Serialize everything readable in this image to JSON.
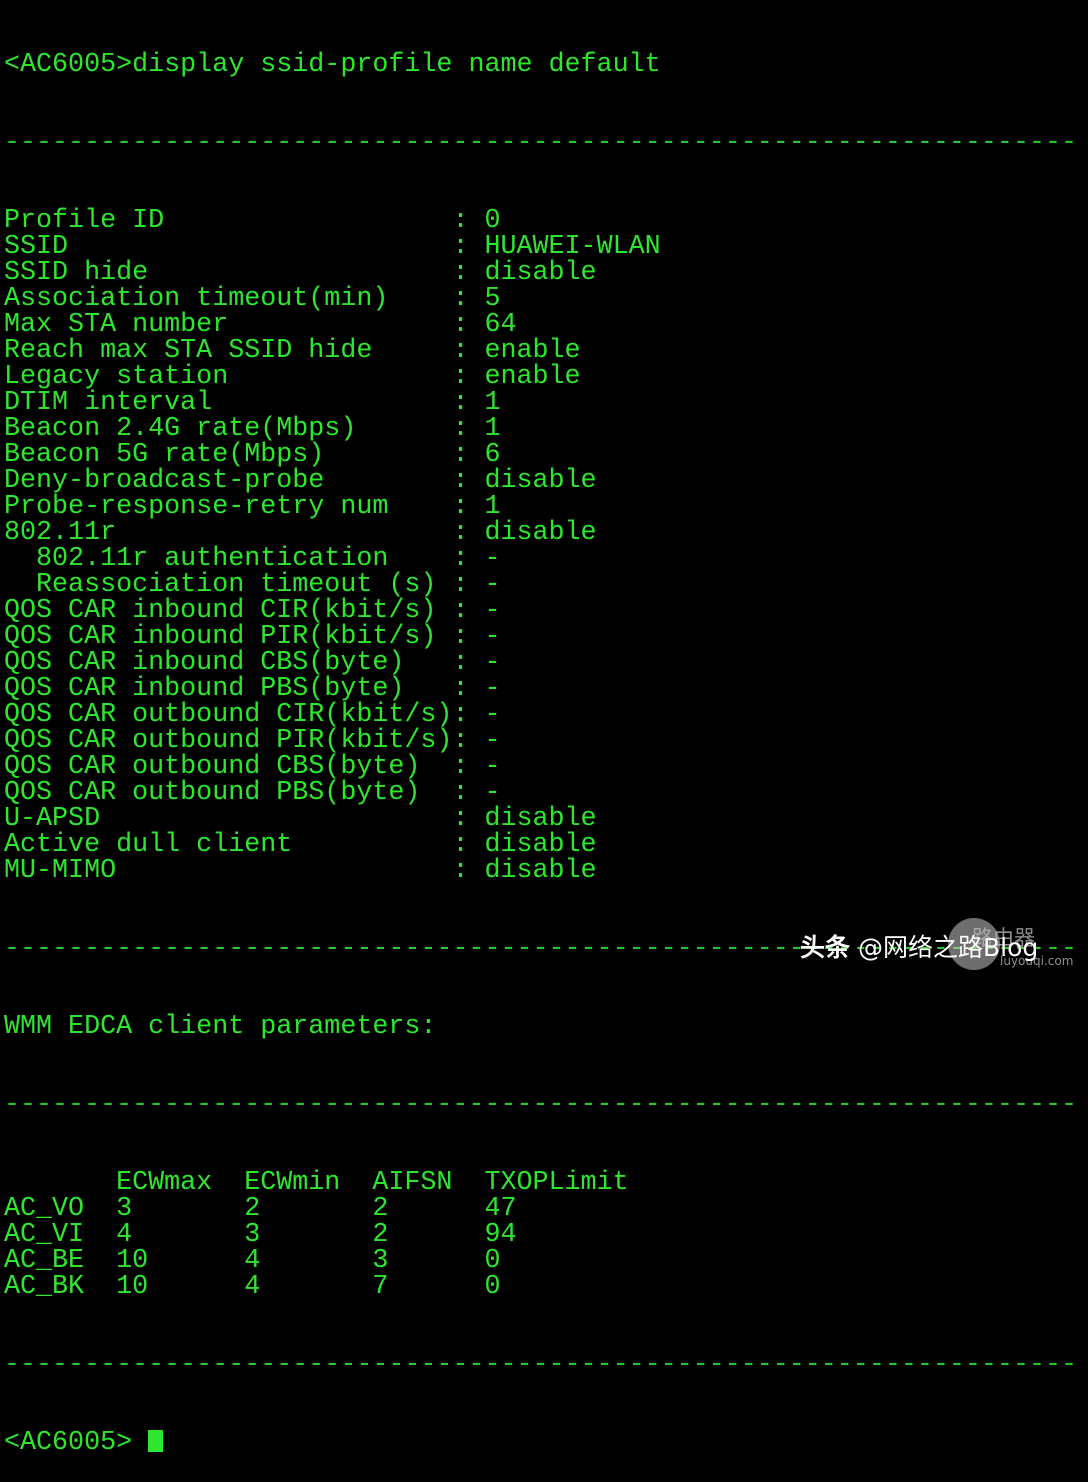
{
  "terminal": {
    "command_line": "<AC6005>display ssid-profile name default",
    "separator": "-------------------------------------------------------------------",
    "fields": [
      {
        "label": "Profile ID",
        "value": "0"
      },
      {
        "label": "SSID",
        "value": "HUAWEI-WLAN"
      },
      {
        "label": "SSID hide",
        "value": "disable"
      },
      {
        "label": "Association timeout(min)",
        "value": "5"
      },
      {
        "label": "Max STA number",
        "value": "64"
      },
      {
        "label": "Reach max STA SSID hide",
        "value": "enable"
      },
      {
        "label": "Legacy station",
        "value": "enable"
      },
      {
        "label": "DTIM interval",
        "value": "1"
      },
      {
        "label": "Beacon 2.4G rate(Mbps)",
        "value": "1"
      },
      {
        "label": "Beacon 5G rate(Mbps)",
        "value": "6"
      },
      {
        "label": "Deny-broadcast-probe",
        "value": "disable"
      },
      {
        "label": "Probe-response-retry num",
        "value": "1"
      },
      {
        "label": "802.11r",
        "value": "disable"
      },
      {
        "label": "  802.11r authentication",
        "value": "-"
      },
      {
        "label": "  Reassociation timeout (s)",
        "value": "-"
      },
      {
        "label": "QOS CAR inbound CIR(kbit/s)",
        "value": "-"
      },
      {
        "label": "QOS CAR inbound PIR(kbit/s)",
        "value": "-"
      },
      {
        "label": "QOS CAR inbound CBS(byte)",
        "value": "-"
      },
      {
        "label": "QOS CAR inbound PBS(byte)",
        "value": "-"
      },
      {
        "label": "QOS CAR outbound CIR(kbit/s)",
        "value": "-"
      },
      {
        "label": "QOS CAR outbound PIR(kbit/s)",
        "value": "-"
      },
      {
        "label": "QOS CAR outbound CBS(byte)",
        "value": "-"
      },
      {
        "label": "QOS CAR outbound PBS(byte)",
        "value": "-"
      },
      {
        "label": "U-APSD",
        "value": "disable"
      },
      {
        "label": "Active dull client",
        "value": "disable"
      },
      {
        "label": "MU-MIMO",
        "value": "disable"
      }
    ],
    "wmm_title": "WMM EDCA client parameters:",
    "wmm_headers": [
      "",
      "ECWmax",
      "ECWmin",
      "AIFSN",
      "TXOPLimit"
    ],
    "wmm_rows": [
      [
        "AC_VO",
        "3",
        "2",
        "2",
        "47"
      ],
      [
        "AC_VI",
        "4",
        "3",
        "2",
        "94"
      ],
      [
        "AC_BE",
        "10",
        "4",
        "3",
        "0"
      ],
      [
        "AC_BK",
        "10",
        "4",
        "7",
        "0"
      ]
    ],
    "prompt": "<AC6005> "
  },
  "watermark": {
    "brand": "头条",
    "author": "@网络之路Blog",
    "site_name": "路由器",
    "site_url": "luyouqi.com"
  },
  "colors": {
    "text": "#2fe62f",
    "background": "#000000"
  }
}
